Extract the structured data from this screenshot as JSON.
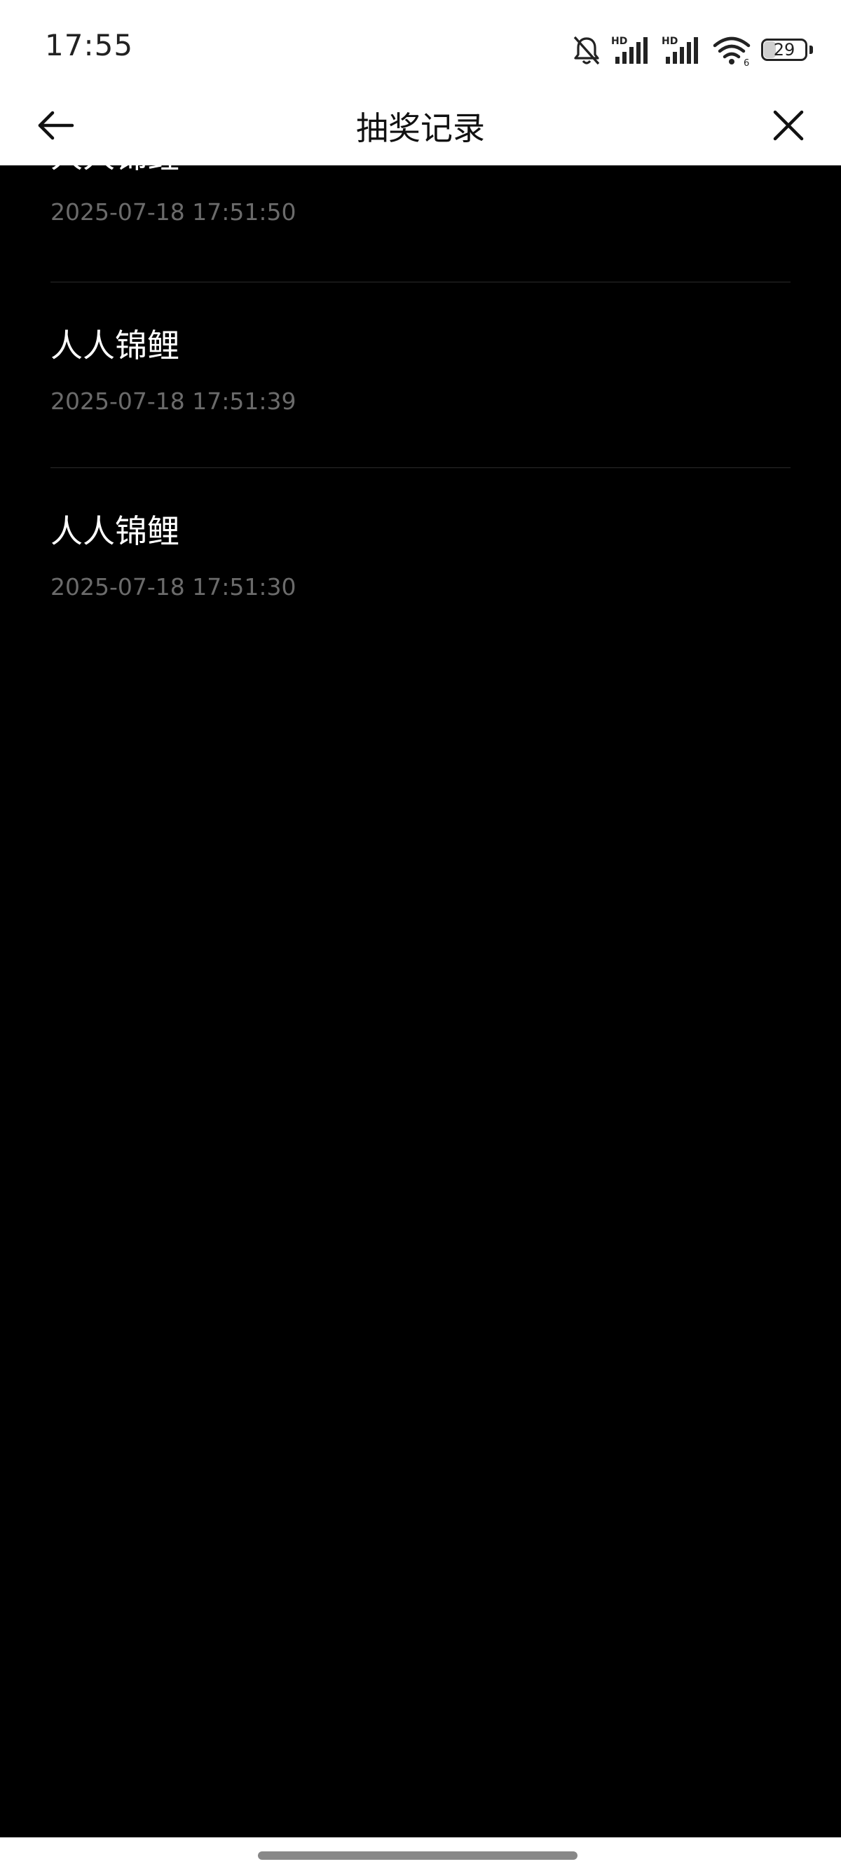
{
  "status_bar": {
    "time": "17:55",
    "battery_level": "29",
    "battery_fraction": 0.29,
    "icons": [
      "bell-muted-icon",
      "signal-hd-icon",
      "signal-hd-icon",
      "wifi-icon",
      "battery-icon"
    ],
    "hd_label": "HD",
    "wifi_sub": "6"
  },
  "header": {
    "title": "抽奖记录",
    "back_icon": "arrow-left-icon",
    "close_icon": "close-icon"
  },
  "records": [
    {
      "title": "人人锦鲤",
      "time": "2025-07-18 17:51:50"
    },
    {
      "title": "人人锦鲤",
      "time": "2025-07-18 17:51:39"
    },
    {
      "title": "人人锦鲤",
      "time": "2025-07-18 17:51:30"
    }
  ],
  "colors": {
    "content_background": "#000000",
    "header_background": "#ffffff",
    "title_text": "#ffffff",
    "time_text": "#6b6b6b"
  }
}
